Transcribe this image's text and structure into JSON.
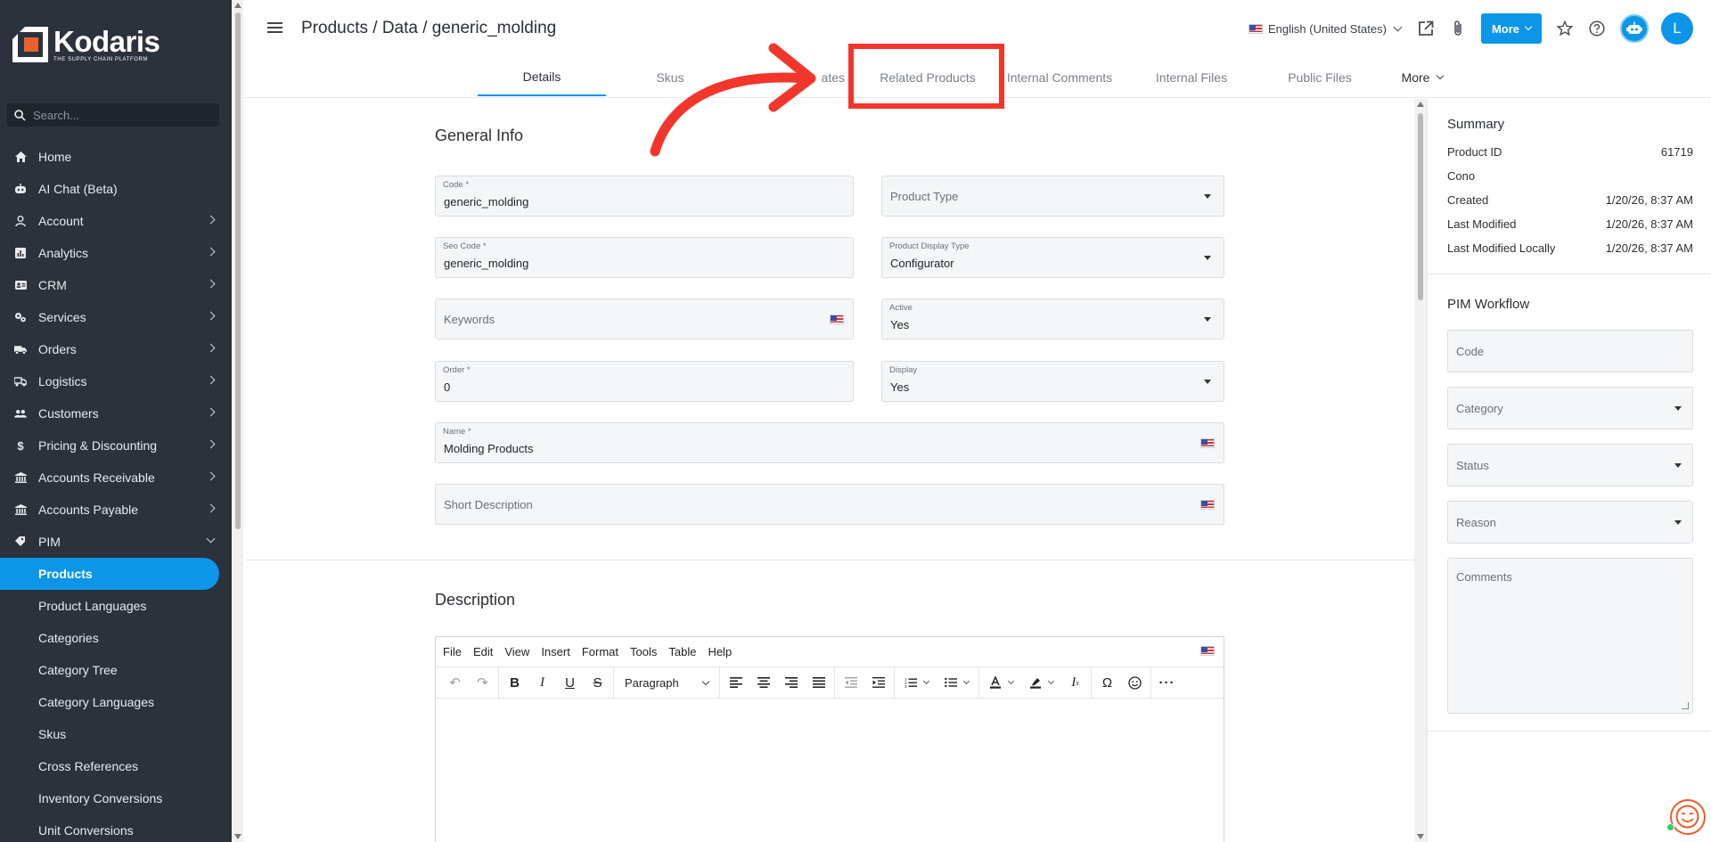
{
  "app": {
    "logo_text": "Kodaris",
    "logo_tagline": "THE SUPPLY CHAIN PLATFORM"
  },
  "sidebar": {
    "search_placeholder": "Search...",
    "items": [
      {
        "label": "Home",
        "icon": "home-icon",
        "chevron": "none"
      },
      {
        "label": "AI Chat (Beta)",
        "icon": "robot-icon",
        "chevron": "none"
      },
      {
        "label": "Account",
        "icon": "person-icon",
        "chevron": "right"
      },
      {
        "label": "Analytics",
        "icon": "chart-icon",
        "chevron": "right"
      },
      {
        "label": "CRM",
        "icon": "contact-card-icon",
        "chevron": "right"
      },
      {
        "label": "Services",
        "icon": "gears-icon",
        "chevron": "right"
      },
      {
        "label": "Orders",
        "icon": "truck-icon",
        "chevron": "right"
      },
      {
        "label": "Logistics",
        "icon": "shipping-icon",
        "chevron": "right"
      },
      {
        "label": "Customers",
        "icon": "people-icon",
        "chevron": "right"
      },
      {
        "label": "Pricing & Discounting",
        "icon": "dollar-icon",
        "chevron": "right"
      },
      {
        "label": "Accounts Receivable",
        "icon": "bank-icon",
        "chevron": "right"
      },
      {
        "label": "Accounts Payable",
        "icon": "bank-icon",
        "chevron": "right"
      },
      {
        "label": "PIM",
        "icon": "tag-icon",
        "chevron": "down"
      }
    ],
    "pim_children": [
      {
        "label": "Products",
        "active": true
      },
      {
        "label": "Product Languages"
      },
      {
        "label": "Categories"
      },
      {
        "label": "Category Tree"
      },
      {
        "label": "Category Languages"
      },
      {
        "label": "Skus"
      },
      {
        "label": "Cross References"
      },
      {
        "label": "Inventory Conversions"
      },
      {
        "label": "Unit Conversions"
      }
    ]
  },
  "header": {
    "breadcrumb": "Products / Data / generic_molding",
    "language": "English (United States)",
    "more_label": "More",
    "avatar_initial": "L"
  },
  "tabs": [
    {
      "label": "Details",
      "active": true
    },
    {
      "label": "Skus"
    },
    {
      "label": "ates"
    },
    {
      "label": "Related Products"
    },
    {
      "label": "Internal Comments"
    },
    {
      "label": "Internal Files"
    },
    {
      "label": "Public Files"
    },
    {
      "label": "More"
    }
  ],
  "general_info": {
    "title": "General Info",
    "code": {
      "label": "Code *",
      "value": "generic_molding"
    },
    "product_type": {
      "placeholder": "Product Type"
    },
    "seo_code": {
      "label": "Seo Code *",
      "value": "generic_molding"
    },
    "product_display_type": {
      "label": "Product Display Type",
      "value": "Configurator"
    },
    "keywords": {
      "placeholder": "Keywords"
    },
    "active": {
      "label": "Active",
      "value": "Yes"
    },
    "order": {
      "label": "Order *",
      "value": "0"
    },
    "display": {
      "label": "Display",
      "value": "Yes"
    },
    "name": {
      "label": "Name *",
      "value": "Molding Products"
    },
    "short_description": {
      "placeholder": "Short Description"
    }
  },
  "description": {
    "title": "Description",
    "menu": [
      "File",
      "Edit",
      "View",
      "Insert",
      "Format",
      "Tools",
      "Table",
      "Help"
    ],
    "block_format": "Paragraph"
  },
  "summary": {
    "title": "Summary",
    "rows": [
      {
        "key": "Product ID",
        "value": "61719"
      },
      {
        "key": "Cono",
        "value": ""
      },
      {
        "key": "Created",
        "value": "1/20/26, 8:37 AM"
      },
      {
        "key": "Last Modified",
        "value": "1/20/26, 8:37 AM"
      },
      {
        "key": "Last Modified Locally",
        "value": "1/20/26, 8:37 AM"
      }
    ]
  },
  "pim_workflow": {
    "title": "PIM Workflow",
    "code_placeholder": "Code",
    "category_placeholder": "Category",
    "status_placeholder": "Status",
    "reason_placeholder": "Reason",
    "comments_placeholder": "Comments"
  },
  "colors": {
    "accent": "#0d95e8",
    "sidebar_bg": "#2b323c",
    "annotation": "#f2362b",
    "logo_orange": "#e8632b"
  }
}
